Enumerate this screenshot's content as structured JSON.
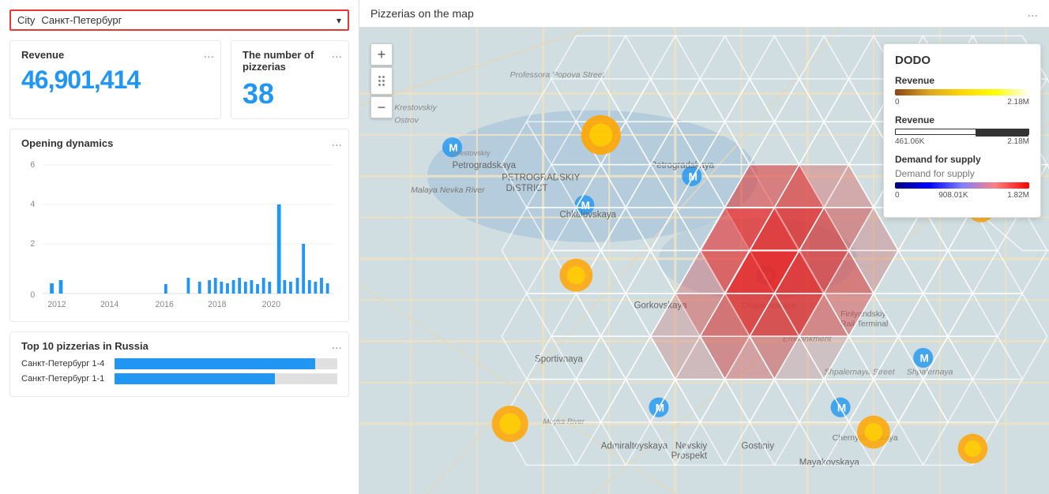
{
  "city_selector": {
    "label": "City",
    "value": "Санкт-Петербург",
    "chevron": "▾"
  },
  "revenue_card": {
    "title": "Revenue",
    "value": "46,901,414",
    "menu": "..."
  },
  "pizzerias_card": {
    "title": "The number of pizzerias",
    "value": "38",
    "menu": "..."
  },
  "opening_dynamics": {
    "title": "Opening dynamics",
    "menu": "...",
    "x_labels": [
      "2012",
      "2014",
      "2016",
      "2018",
      "2020"
    ],
    "y_labels": [
      "6",
      "4",
      "2",
      "0"
    ]
  },
  "top10": {
    "title": "Top 10 pizzerias in Russia",
    "menu": "...",
    "items": [
      {
        "label": "Санкт-Петербург 1-4",
        "pct": 90
      },
      {
        "label": "Санкт-Петербург 1-1",
        "pct": 72
      }
    ]
  },
  "map_panel": {
    "title": "Pizzerias on the map",
    "menu": "..."
  },
  "legend": {
    "title": "DODO",
    "revenue_title": "Revenue",
    "revenue_min": "0",
    "revenue_max": "2.18M",
    "revenue_range_min": "461.06K",
    "revenue_range_max": "2.18M",
    "demand_title": "Demand for supply",
    "demand_subtitle": "Demand for supply",
    "demand_min": "0",
    "demand_mid": "908.01K",
    "demand_max": "1.82M"
  },
  "map_controls": {
    "zoom_in": "+",
    "zoom_out": "−"
  }
}
